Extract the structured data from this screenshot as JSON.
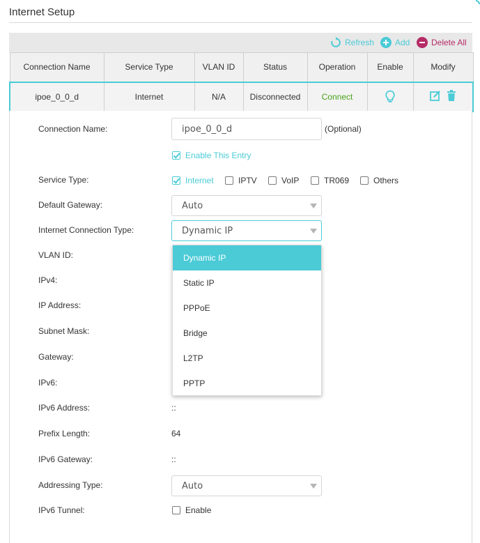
{
  "page": {
    "title": "Internet Setup"
  },
  "toolbar": {
    "refresh_label": "Refresh",
    "add_label": "Add",
    "delete_all_label": "Delete All"
  },
  "table": {
    "headers": [
      "Connection Name",
      "Service Type",
      "VLAN ID",
      "Status",
      "Operation",
      "Enable",
      "Modify"
    ],
    "row": {
      "name": "ipoe_0_0_d",
      "service_type": "Internet",
      "vlan_id": "N/A",
      "status": "Disconnected",
      "operation": "Connect"
    }
  },
  "form": {
    "connection_name_label": "Connection Name:",
    "connection_name_value": "ipoe_0_0_d",
    "optional_hint": "(Optional)",
    "enable_entry_label": "Enable This Entry",
    "service_type_label": "Service Type:",
    "service_options": [
      "Internet",
      "IPTV",
      "VoIP",
      "TR069",
      "Others"
    ],
    "default_gateway_label": "Default Gateway:",
    "default_gateway_value": "Auto",
    "conn_type_label": "Internet Connection Type:",
    "conn_type_value": "Dynamic IP",
    "vlan_id_label": "VLAN ID:",
    "ipv4_label": "IPv4:",
    "ip_address_label": "IP Address:",
    "subnet_mask_label": "Subnet Mask:",
    "gateway_label": "Gateway:",
    "ipv6_label": "IPv6:",
    "ipv6_address_label": "IPv6 Address:",
    "ipv6_address_value": "::",
    "prefix_length_label": "Prefix Length:",
    "prefix_length_value": "64",
    "ipv6_gateway_label": "IPv6 Gateway:",
    "ipv6_gateway_value": "::",
    "addressing_type_label": "Addressing Type:",
    "addressing_type_value": "Auto",
    "ipv6_tunnel_label": "IPv6 Tunnel:",
    "ipv6_tunnel_option": "Enable"
  },
  "dropdown": {
    "options": [
      "Dynamic IP",
      "Static IP",
      "PPPoE",
      "Bridge",
      "L2TP",
      "PPTP"
    ],
    "selected": "Dynamic IP"
  },
  "colors": {
    "accent": "#4acbd6",
    "connect": "#49a21a",
    "delete": "#b52c66"
  }
}
